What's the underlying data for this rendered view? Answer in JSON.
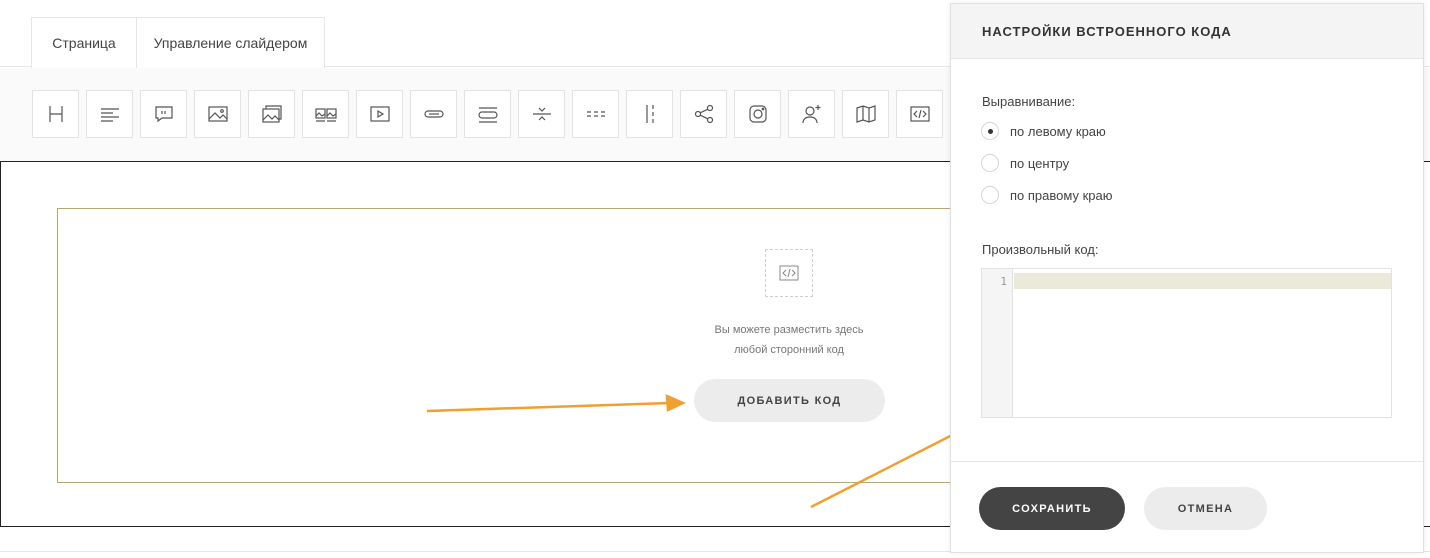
{
  "tabs": [
    {
      "label": "Страница",
      "active": true
    },
    {
      "label": "Управление слайдером",
      "active": false
    }
  ],
  "toolbar": {
    "tools": [
      {
        "icon": "heading-icon"
      },
      {
        "icon": "text-align-icon"
      },
      {
        "icon": "quote-icon"
      },
      {
        "icon": "image-icon"
      },
      {
        "icon": "gallery-icon"
      },
      {
        "icon": "images-pair-icon"
      },
      {
        "icon": "video-icon"
      },
      {
        "icon": "button-icon"
      },
      {
        "icon": "buttons-group-icon"
      },
      {
        "icon": "divider-icon"
      },
      {
        "icon": "dashed-divider-icon"
      },
      {
        "icon": "column-divider-icon"
      },
      {
        "icon": "share-icon"
      },
      {
        "icon": "instagram-icon"
      },
      {
        "icon": "add-user-icon"
      },
      {
        "icon": "map-icon"
      },
      {
        "icon": "embed-code-icon"
      }
    ]
  },
  "canvas": {
    "hint_line1": "Вы можете разместить здесь",
    "hint_line2": "любой сторонний код",
    "add_code_label": "ДОБАВИТЬ КОД"
  },
  "panel": {
    "title": "НАСТРОЙКИ ВСТРОЕННОГО КОДА",
    "alignment_label": "Выравнивание:",
    "alignment_options": [
      {
        "label": "по левому краю",
        "checked": true
      },
      {
        "label": "по центру",
        "checked": false
      },
      {
        "label": "по правому краю",
        "checked": false
      }
    ],
    "code_label": "Произвольный код:",
    "line_number": "1",
    "save_label": "СОХРАНИТЬ",
    "cancel_label": "ОТМЕНА"
  },
  "colors": {
    "arrow": "#f0a030",
    "block_border": "#b3a879",
    "save_bg": "#444444"
  }
}
